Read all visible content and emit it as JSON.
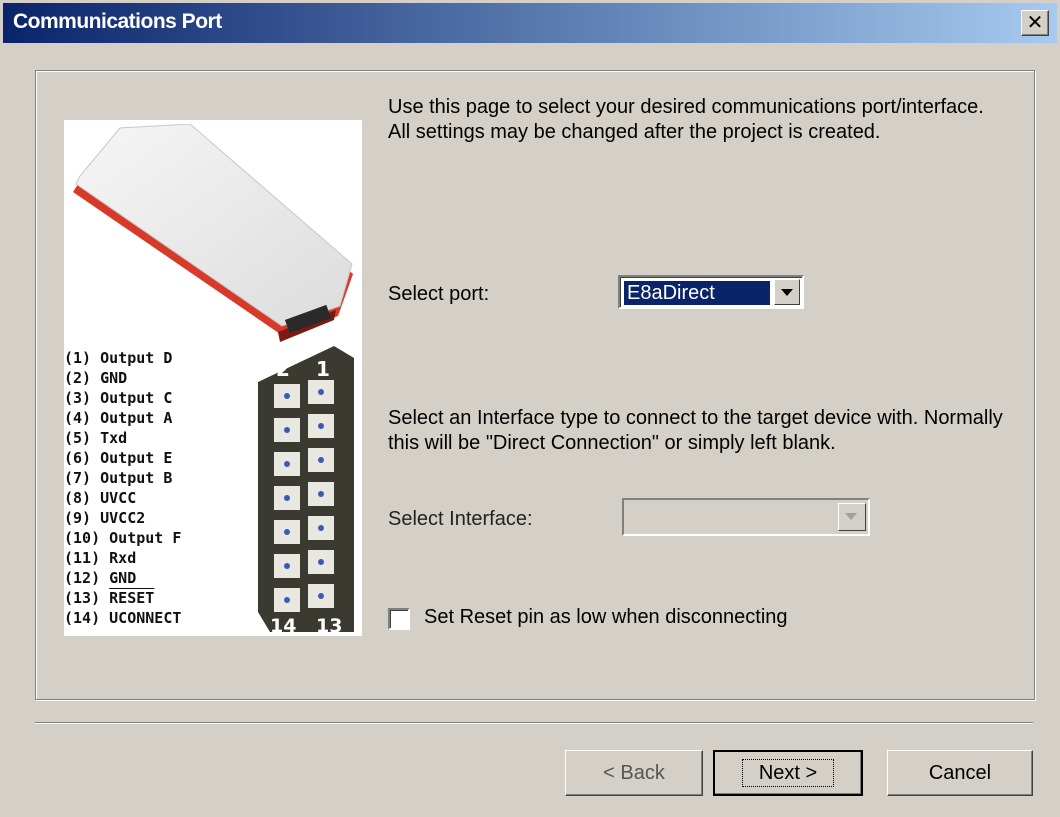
{
  "window": {
    "title": "Communications Port",
    "close_glyph": "✕"
  },
  "description": "Use this page to select your desired communications port/interface. All settings may be changed after the project is created.",
  "port": {
    "label": "Select port:",
    "value": "E8aDirect"
  },
  "interface": {
    "description": "Select an Interface type to connect to the target device with. Normally this will be \"Direct Connection\" or simply left blank.",
    "label": "Select Interface:",
    "value": ""
  },
  "checkbox": {
    "label": "Set Reset pin as low when disconnecting",
    "checked": false
  },
  "pins": [
    "(1) Output D",
    "(2) GND",
    "(3) Output C",
    "(4) Output A",
    "(5) Txd",
    "(6) Output E",
    "(7) Output B",
    "(8) UVCC",
    "(9) UVCC2",
    "(10) Output F",
    "(11) Rxd",
    "(12) GND",
    "(13) ",
    "(14) UCONNECT"
  ],
  "pin13_overline": "RESET",
  "board_labels": {
    "top_left": "2",
    "top_right": "1",
    "bottom_left": "14",
    "bottom_right": "13"
  },
  "buttons": {
    "back": "< Back",
    "next": "Next >",
    "cancel": "Cancel"
  },
  "colors": {
    "titlebar_start": "#0a246a",
    "titlebar_end": "#a6caf0",
    "face": "#d4d0c8",
    "device_red": "#d83a2a"
  }
}
